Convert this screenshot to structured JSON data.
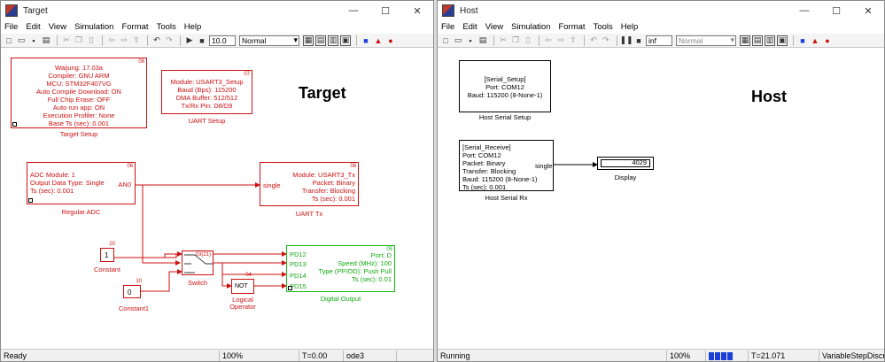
{
  "menu": [
    "File",
    "Edit",
    "View",
    "Simulation",
    "Format",
    "Tools",
    "Help"
  ],
  "target": {
    "title": "Target",
    "stop_time": "10.0",
    "sim_mode": "Normal",
    "status": {
      "state": "Ready",
      "zoom": "100%",
      "time": "T=0.00",
      "solver": "ode3"
    },
    "heading": "Target",
    "blocks": {
      "setup": {
        "num": "08",
        "lines": [
          "Waijung: 17.03a",
          "Compiler: GNU ARM",
          "MCU: STM32F407VG",
          "Auto Compile Download: ON",
          "Full Chip Erase: OFF",
          "Auto run app: ON",
          "Execution Profiler: None",
          "Base Ts (sec): 0.001"
        ],
        "label": "Target Setup"
      },
      "uart_setup": {
        "num": "07",
        "lines": [
          "Module: USART3_Setup",
          "Baud (Bps): 115200",
          "DMA Buffer: 512/512",
          "Tx/Rx Pin: D8/D9"
        ],
        "label": "UART Setup"
      },
      "adc": {
        "num": "06",
        "lines": [
          "ADC Module: 1",
          "Output Data Type: Single",
          "Ts (sec): 0.001"
        ],
        "port": "AN0",
        "label": "Regular ADC"
      },
      "uart_tx": {
        "num": "08",
        "lines": [
          "Module: USART3_Tx",
          "Packet: Binary",
          "Transfer: Blocking",
          "Ts (sec): 0.001"
        ],
        "port": "single",
        "label": "UART Tx"
      },
      "constant": {
        "num": "20",
        "value": "1",
        "label": "Constant"
      },
      "constant1": {
        "num": "10",
        "value": "0",
        "label": "Constant1"
      },
      "switch": {
        "num": "03(21)",
        "label": "Switch"
      },
      "not": {
        "num": "04",
        "text": "NOT",
        "label": "Logical\nOperator"
      },
      "digital": {
        "num": "05",
        "ports": [
          "PD12",
          "PD13",
          "PD14",
          "PD15"
        ],
        "lines": [
          "Port: D",
          "Speed (MHz): 100",
          "Type (PP/OD): Push Pull",
          "Ts (sec): 0.01"
        ],
        "label": "Digital Output"
      }
    }
  },
  "host": {
    "title": "Host",
    "stop_time": "inf",
    "sim_mode": "Normal",
    "status": {
      "state": "Running",
      "zoom": "100%",
      "progress_blocks": 4,
      "time": "T=21.071",
      "solver": "VariableStepDiscrete"
    },
    "heading": "Host",
    "blocks": {
      "serial_setup": {
        "lines": [
          "[Serial_Setup]",
          "Port: COM12",
          "Baud: 115200 (8-None-1)"
        ],
        "label": "Host Serial Setup"
      },
      "serial_rx": {
        "lines": [
          "[Serial_Receive]",
          "Port: COM12",
          "Packet: Binary",
          "Transfer: Blocking",
          "Baud: 115200 (8-None-1)",
          "Ts (sec): 0.001"
        ],
        "port": "single",
        "label": "Host Serial Rx"
      },
      "display": {
        "value": "4029",
        "label": "Display"
      }
    }
  },
  "colors": {
    "target_block": "#cc1111",
    "digital_block": "#11bb11",
    "progress": "#1a3fd6"
  }
}
